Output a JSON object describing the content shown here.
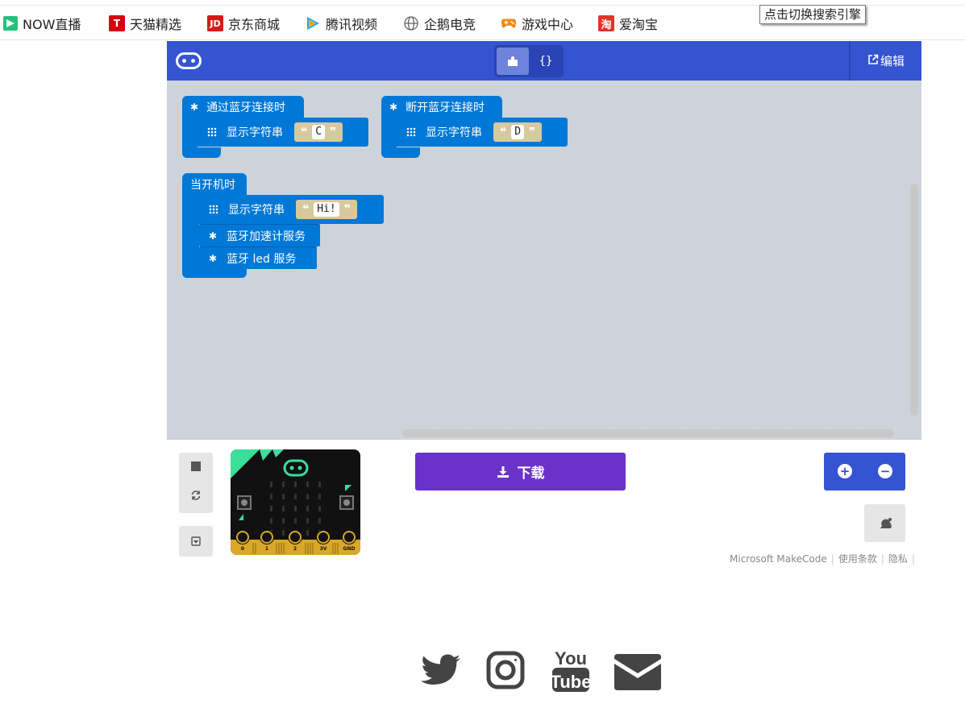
{
  "browser": {
    "bookmarks": [
      {
        "label": "NOW直播",
        "icon": "now-icon",
        "color": "#27c07b"
      },
      {
        "label": "天猫精选",
        "icon": "tmall-icon",
        "color": "#d6000f"
      },
      {
        "label": "京东商城",
        "icon": "jd-icon",
        "color": "#d71a18"
      },
      {
        "label": "腾讯视频",
        "icon": "tencent-video-icon",
        "color": "#2f9dfc"
      },
      {
        "label": "企鹅电竞",
        "icon": "globe-icon",
        "color": "#666666"
      },
      {
        "label": "游戏中心",
        "icon": "gamepad-icon",
        "color": "#f08a14"
      },
      {
        "label": "爱淘宝",
        "icon": "taobao-icon",
        "color": "#e8322b"
      }
    ],
    "search_tooltip": "点击切换搜索引擎"
  },
  "header": {
    "logo": "microbit-logo-icon",
    "view_toggle": {
      "blocks_icon": "puzzle-icon",
      "js_label": "{}"
    },
    "edit_label": "编辑",
    "accent": "#3454d1"
  },
  "workspace": {
    "blocks": [
      {
        "hat": "通过蓝牙连接时",
        "statements": [
          {
            "type": "show-string",
            "label": "显示字符串",
            "value": "C"
          }
        ]
      },
      {
        "hat": "断开蓝牙连接时",
        "statements": [
          {
            "type": "show-string",
            "label": "显示字符串",
            "value": "D"
          }
        ]
      },
      {
        "hat": "当开机时",
        "statements": [
          {
            "type": "show-string",
            "label": "显示字符串",
            "value": "Hi!"
          },
          {
            "type": "bluetooth",
            "label": "蓝牙加速计服务"
          },
          {
            "type": "bluetooth",
            "label": "蓝牙 led 服务"
          }
        ]
      }
    ]
  },
  "simulator": {
    "pins": [
      "0",
      "1",
      "2",
      "3V",
      "GND"
    ],
    "download_label": "下载",
    "download_color": "#6b32c9"
  },
  "footer": {
    "links": [
      "Microsoft MakeCode",
      "使用条款",
      "隐私"
    ]
  },
  "social": [
    "twitter-icon",
    "instagram-icon",
    "youtube-icon",
    "email-icon"
  ],
  "social_youtube_text": [
    "You",
    "Tube"
  ]
}
